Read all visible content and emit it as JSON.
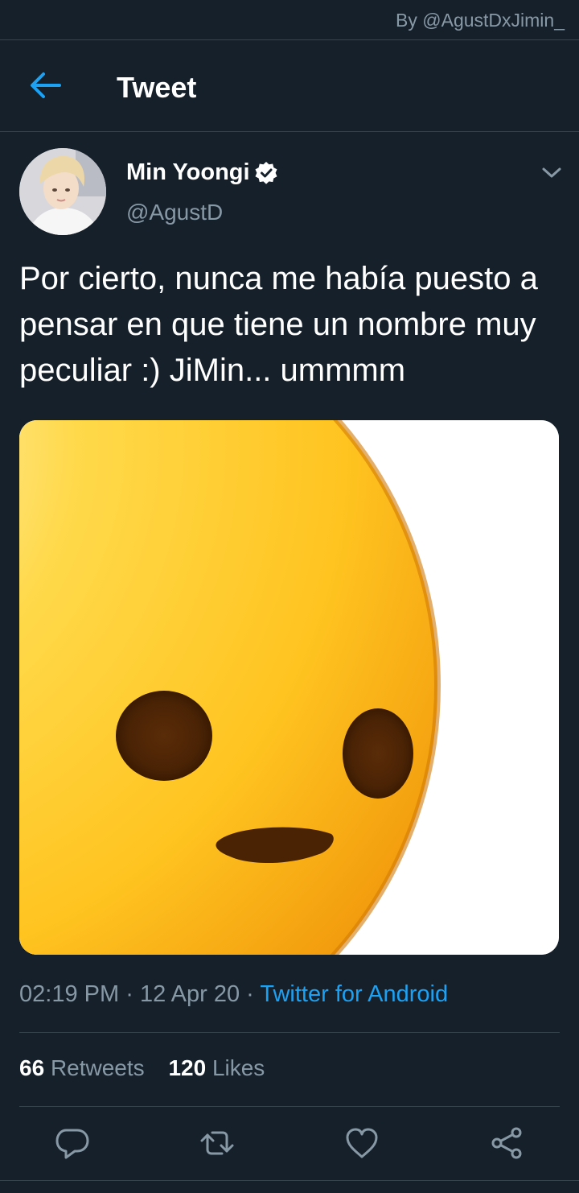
{
  "watermark": "By @AgustDxJimin_",
  "header": {
    "title": "Tweet",
    "back_icon": "arrow-left-icon"
  },
  "tweet": {
    "author_name": "Min Yoongi",
    "author_handle": "@AgustD",
    "verified": true,
    "text": "Por cierto, nunca me había puesto a pensar en que tiene un nombre muy peculiar :) JiMin... ummmm",
    "time": "02:19 PM",
    "date": "12 Apr 20",
    "separator": "·",
    "source": "Twitter for Android",
    "retweet_count": "66",
    "retweet_label": "Retweets",
    "like_count": "120",
    "like_label": "Likes",
    "media": "neutral-face-emoji-image"
  },
  "actions": [
    "reply-icon",
    "retweet-icon",
    "like-icon",
    "share-icon"
  ],
  "colors": {
    "background": "#15202b",
    "accent": "#1da1f2",
    "secondary_text": "#8899a6",
    "divider": "#38444d"
  }
}
